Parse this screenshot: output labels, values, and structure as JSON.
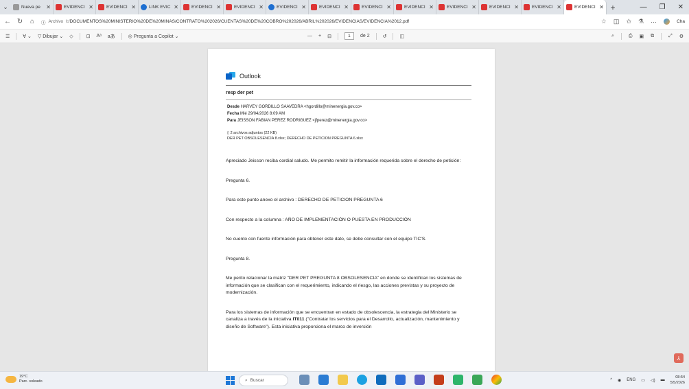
{
  "browser": {
    "tabs": [
      {
        "label": "Nueva pe",
        "icon": "page-icon",
        "kind": "grey"
      },
      {
        "label": "EVIDENCI",
        "icon": "pdf-icon",
        "kind": "pdf"
      },
      {
        "label": "EVIDENCI",
        "icon": "pdf-icon",
        "kind": "pdf"
      },
      {
        "label": "LINK EVIC",
        "icon": "link-icon",
        "kind": "blue"
      },
      {
        "label": "EVIDENCI",
        "icon": "pdf-icon",
        "kind": "pdf"
      },
      {
        "label": "EVIDENCI",
        "icon": "pdf-icon",
        "kind": "pdf"
      },
      {
        "label": "EVIDENCI",
        "icon": "link-icon",
        "kind": "blue"
      },
      {
        "label": "EVIDENCI",
        "icon": "pdf-icon",
        "kind": "pdf"
      },
      {
        "label": "EVIDENCI",
        "icon": "pdf-icon",
        "kind": "pdf"
      },
      {
        "label": "EVIDENCI",
        "icon": "pdf-icon",
        "kind": "pdf"
      },
      {
        "label": "EVIDENCI",
        "icon": "pdf-icon",
        "kind": "pdf"
      },
      {
        "label": "EVIDENCI",
        "icon": "pdf-icon",
        "kind": "pdf"
      },
      {
        "label": "EVIDENCI",
        "icon": "pdf-icon",
        "kind": "pdf"
      },
      {
        "label": "EVIDENCI",
        "icon": "pdf-icon",
        "kind": "pdf"
      }
    ],
    "url_protocol": "Archivo",
    "url": "I:/DOCUMENTOS%20MINISTERIO%20DE%20MINAS/CONTRATO%202026/CUENTAS%20DE%20COBRO%202026/ABRIL%202026/EVIDENCIAS/EVIDENCIA%2012.pdf",
    "profile_label": "Cha"
  },
  "pdf_toolbar": {
    "draw_label": "Dibujar",
    "copilot_label": "Pregunta a Copilot",
    "current_page": "1",
    "page_total": "de 2",
    "zoom_minus": "—",
    "zoom_plus": "+"
  },
  "email": {
    "app_title": "Outlook",
    "subject": "resp der pet",
    "from_label": "Desde",
    "from_value": "HARVEY GORDILLO SAAVEDRA <hgordillo@minenergia.gov.co>",
    "date_label": "Fecha",
    "date_value": "Mié 29/04/2026 8:09 AM",
    "to_label": "Para",
    "to_value": "JEISSON FABIAN PEREZ RODRIGUEZ <jfperez@minenergia.gov.co>",
    "attachments_count": "2 archivos adjuntos (22 KB)",
    "attachments_list": "DER PET OBSOLESENCIA 8.xlsx; DERECHO DE PETICION PREGUNTA 6.xlsx",
    "p1": "Apreciado Jeisson reciba cordial saludo. Me permito remitir la información requerida sobre el derecho de petición:",
    "p2": "Pregunta 6.",
    "p3": "Para este punto anexo el archivo : DERECHO DE PETICION PREGUNTA  6",
    "p4": "Con respecto a la columna : AÑO DE IMPLEMENTACIÓN O PUESTA EN PRODUCCIÓN",
    "p5": "No cuento con fuente información para obtener este dato, se debe consultar con el equipo TIC'S.",
    "p6": " Pregunta 8.",
    "p7": "Me perito relacionar la matriz \"DER PET PREGUNTA 8 OBSOLESENCIA\" en donde se identifican los sistemas de información     que se clasifican con el requerimiento, indicando el riesgo, las acciones previstas y su proyecto de modernización.",
    "p8a": "Para los sistemas de información que se encuentran en estado de obsolescencia, la estrategia del Ministerio se canaliza a través de la iniciativa ",
    "p8b": "IT011",
    "p8c": " (\"Contratar los servicios para el Desarrollo, actualización, mantenimiento y diseño de Software\"). Esta iniciativa proporciona el marco de inversión"
  },
  "taskbar": {
    "weather_temp": "19°C",
    "weather_desc": "Parc. soleado",
    "search_placeholder": "Buscar",
    "lang": "ENG",
    "time": "08:54",
    "date": "5/5/2026"
  }
}
